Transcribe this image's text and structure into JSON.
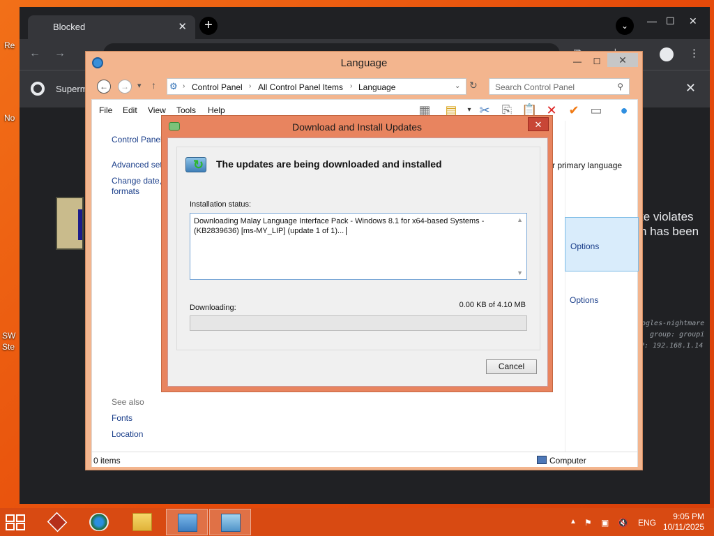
{
  "browser": {
    "tab_title": "Blocked",
    "new_tab": "+",
    "profile_button": "⌄",
    "tab_close": "✕",
    "infobar_text": "Superm",
    "blocked_text_line1": "te violates",
    "blocked_text_line2": "n has been",
    "mono_line1": "ogles-nightmare",
    "mono_line2": "group: groupi",
    "mono_line3": "P: 192.168.1.14"
  },
  "desktop": {
    "icon_labels": [
      "Re",
      "No",
      "SW",
      "Ste"
    ]
  },
  "control_panel": {
    "title": "Language",
    "breadcrumb": [
      "Control Panel",
      "All Control Panel Items",
      "Language"
    ],
    "search_placeholder": "Search Control Panel",
    "menu": [
      "File",
      "Edit",
      "View",
      "Tools",
      "Help"
    ],
    "sidebar": {
      "home": "Control Panel",
      "advanced": "Advanced set",
      "change_date": "Change date,",
      "formats": "formats",
      "see_also": "See also",
      "fonts": "Fonts",
      "location": "Location"
    },
    "right_text": "r primary language",
    "options": [
      "Options",
      "Options"
    ],
    "status_left": "0 items",
    "status_right": "Computer"
  },
  "update_dialog": {
    "title": "Download and Install Updates",
    "heading": "The updates are being downloaded and installed",
    "installation_status_label": "Installation status:",
    "log_text": "Downloading Malay Language Interface Pack - Windows 8.1 for x64-based Systems - (KB2839636) [ms-MY_LIP] (update 1 of 1)...",
    "downloading_label": "Downloading:",
    "progress_text": "0.00 KB of 4.10 MB",
    "progress_fraction": 0,
    "cancel_label": "Cancel"
  },
  "taskbar": {
    "lang": "ENG",
    "time": "9:05 PM",
    "date": "10/11/2025"
  },
  "colors": {
    "desktop": "#e9560e",
    "taskbar": "#d84a12",
    "dialog_frame": "#e8845f",
    "link": "#1a3e8a"
  }
}
